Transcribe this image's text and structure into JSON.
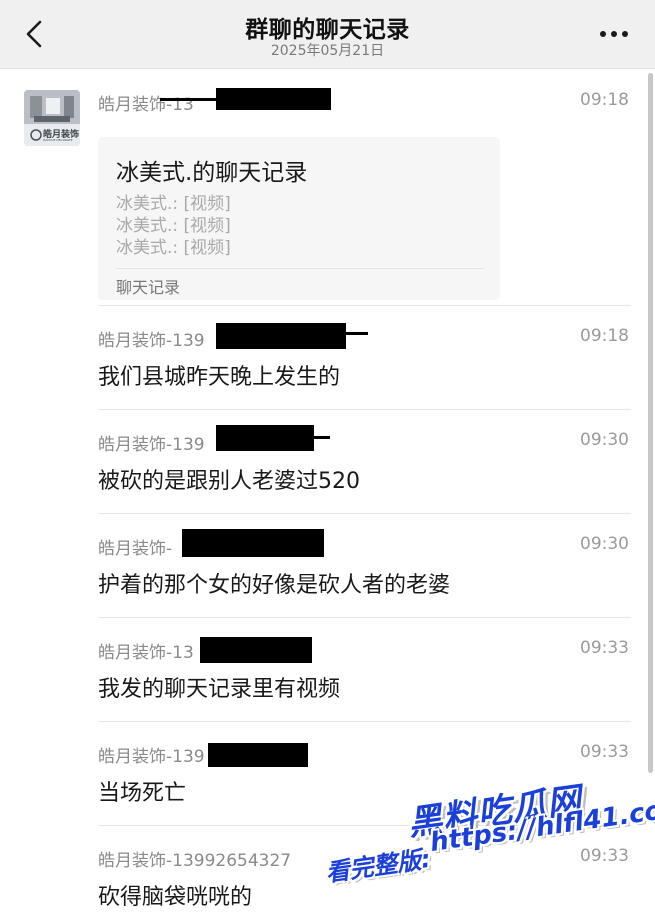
{
  "header": {
    "title": "群聊的聊天记录",
    "date": "2025年05月21日"
  },
  "avatar": {
    "brand": "皓月装饰",
    "brand_sub": "HAOYUE DECORATE"
  },
  "messages": [
    {
      "sender": "皓月装饰-13",
      "time": "09:18",
      "card": {
        "title": "冰美式.的聊天记录",
        "lines": [
          "冰美式.: [视频]",
          "冰美式.: [视频]",
          "冰美式.: [视频]"
        ],
        "footer": "聊天记录"
      }
    },
    {
      "sender": "皓月装饰-139",
      "time": "09:18",
      "text": "我们县城昨天晚上发生的"
    },
    {
      "sender": "皓月装饰-139",
      "time": "09:30",
      "text": "被砍的是跟别人老婆过520"
    },
    {
      "sender": "皓月装饰-",
      "time": "09:30",
      "text": "护着的那个女的好像是砍人者的老婆"
    },
    {
      "sender": "皓月装饰-13",
      "time": "09:33",
      "text": "我发的聊天记录里有视频"
    },
    {
      "sender": "皓月装饰-139",
      "time": "09:33",
      "text": "当场死亡"
    },
    {
      "sender": "皓月装饰-13992654327",
      "time": "09:33",
      "text": "砍得脑袋咣咣的"
    }
  ],
  "watermark": {
    "top": "黑料吃瓜网",
    "url": "https://hlfl41.com",
    "bottom": "看完整版:"
  },
  "colors": {
    "header_bg": "#f0f0f0",
    "watermark_blue": "#1b3fd9",
    "redaction": "#000000"
  }
}
